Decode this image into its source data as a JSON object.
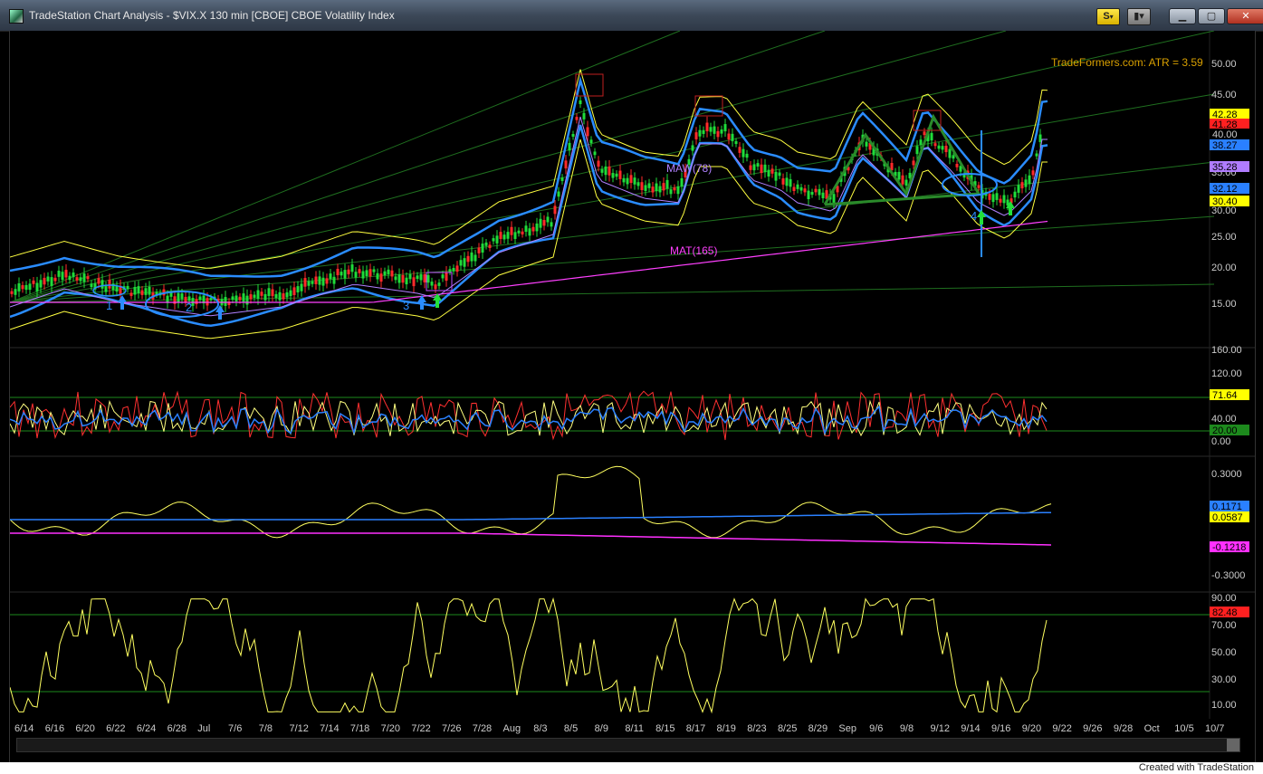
{
  "window": {
    "title": "TradeStation Chart Analysis - $VIX.X 130 min [CBOE] CBOE Volatility Index",
    "s_button": "S",
    "footer": "Created with TradeStation"
  },
  "annotations": {
    "atr": "TradeFormers.com: ATR = 3.59",
    "maw": "MAW(78)",
    "mat": "MAT(165)",
    "wave_labels": [
      "1",
      "2",
      "3",
      "4"
    ]
  },
  "axes": {
    "price_ticks": [
      "50.00",
      "45.00",
      "40.00",
      "35.00",
      "30.00",
      "25.00",
      "20.00",
      "15.00"
    ],
    "ind1_ticks": [
      "160.00",
      "120.00",
      "40.00",
      "0.00"
    ],
    "ind2_ticks": [
      "0.3000",
      "-0.3000"
    ],
    "ind3_ticks": [
      "90.00",
      "70.00",
      "50.00",
      "30.00",
      "10.00"
    ],
    "price_badges": [
      {
        "label": "42.28",
        "bg": "#ffff00",
        "fg": "#000"
      },
      {
        "label": "41.28",
        "bg": "#ff2020",
        "fg": "#000"
      },
      {
        "label": "40.00",
        "bg": "#000000",
        "fg": "#ccc"
      },
      {
        "label": "38.27",
        "bg": "#2a80ff",
        "fg": "#000"
      },
      {
        "label": "35.28",
        "bg": "#b07cff",
        "fg": "#000"
      },
      {
        "label": "32.12",
        "bg": "#2a80ff",
        "fg": "#000"
      },
      {
        "label": "30.40",
        "bg": "#ffff00",
        "fg": "#000"
      }
    ],
    "ind1_badges": [
      {
        "label": "71.64",
        "bg": "#ffff00",
        "fg": "#000"
      },
      {
        "label": "20.00",
        "bg": "#1d8a1d",
        "fg": "#000"
      }
    ],
    "ind2_badges": [
      {
        "label": "0.1171",
        "bg": "#2a80ff",
        "fg": "#000"
      },
      {
        "label": "0.0587",
        "bg": "#ffff00",
        "fg": "#000"
      },
      {
        "label": "-0.1218",
        "bg": "#ff30ff",
        "fg": "#000"
      }
    ],
    "ind3_badges": [
      {
        "label": "82.48",
        "bg": "#ff2020",
        "fg": "#000"
      }
    ],
    "date_ticks": [
      "6/14",
      "6/16",
      "6/20",
      "6/22",
      "6/24",
      "6/28",
      "Jul",
      "7/6",
      "7/8",
      "7/12",
      "7/14",
      "7/18",
      "7/20",
      "7/22",
      "7/26",
      "7/28",
      "Aug",
      "8/3",
      "8/5",
      "8/9",
      "8/11",
      "8/15",
      "8/17",
      "8/19",
      "8/23",
      "8/25",
      "8/29",
      "Sep",
      "9/6",
      "9/8",
      "9/12",
      "9/14",
      "9/16",
      "9/20",
      "9/22",
      "9/26",
      "9/28",
      "Oct",
      "10/5",
      "10/7"
    ]
  },
  "colors": {
    "price_band": "#2a8cff",
    "envelope": "#ffff40",
    "mat": "#ff40ff",
    "maw": "#b080ff",
    "grid": "#1f6f1f",
    "green_pattern": "#2a8a2a"
  },
  "icons": {
    "up_arrow": "up-arrow-icon",
    "minimize": "minimize-icon",
    "maximize": "maximize-icon",
    "close": "close-icon"
  }
}
